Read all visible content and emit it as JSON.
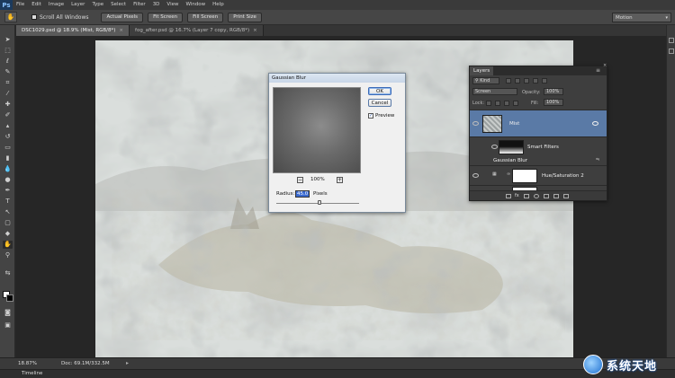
{
  "app": {
    "logo": "Ps"
  },
  "menubar": {
    "items": [
      "File",
      "Edit",
      "Image",
      "Layer",
      "Type",
      "Select",
      "Filter",
      "3D",
      "View",
      "Window",
      "Help"
    ]
  },
  "options": {
    "scroll_all_windows": "Scroll All Windows",
    "buttons": [
      "Actual Pixels",
      "Fit Screen",
      "Fill Screen",
      "Print Size"
    ],
    "workspace": "Motion"
  },
  "tabs": [
    {
      "label": "DSC1029.psd @ 18.9% (Mist, RGB/8*)",
      "active": true
    },
    {
      "label": "fog_after.psd @ 16.7% (Layer 7 copy, RGB/8*)",
      "active": false
    }
  ],
  "gaussian_blur": {
    "title": "Gaussian Blur",
    "ok": "OK",
    "cancel": "Cancel",
    "preview_label": "Preview",
    "preview_checked": true,
    "zoom": "100%",
    "radius_label": "Radius:",
    "radius_value": "45.0",
    "radius_unit": "Pixels",
    "zoom_out": "−",
    "zoom_in": "+"
  },
  "layers_panel": {
    "tab": "Layers",
    "filter_kind": "Kind",
    "blend_mode": "Screen",
    "opacity_label": "Opacity:",
    "opacity_value": "100%",
    "lock_label": "Lock:",
    "fill_label": "Fill:",
    "fill_value": "100%",
    "layers": [
      {
        "name": "Mist",
        "selected": true
      },
      {
        "name": "Smart Filters",
        "selected": false
      },
      {
        "name": "Gaussian Blur",
        "selected": false
      },
      {
        "name": "Hue/Saturation 2",
        "selected": false
      }
    ]
  },
  "status": {
    "zoom": "18.87%",
    "doc": "Doc: 69.1M/332.5M"
  },
  "timeline": {
    "label": "Timeline"
  },
  "watermark": {
    "text": "系统天地"
  },
  "colors": {
    "panel": "#3e3e3e",
    "selection": "#5a7aa6",
    "canvas_bg": "#262626"
  }
}
